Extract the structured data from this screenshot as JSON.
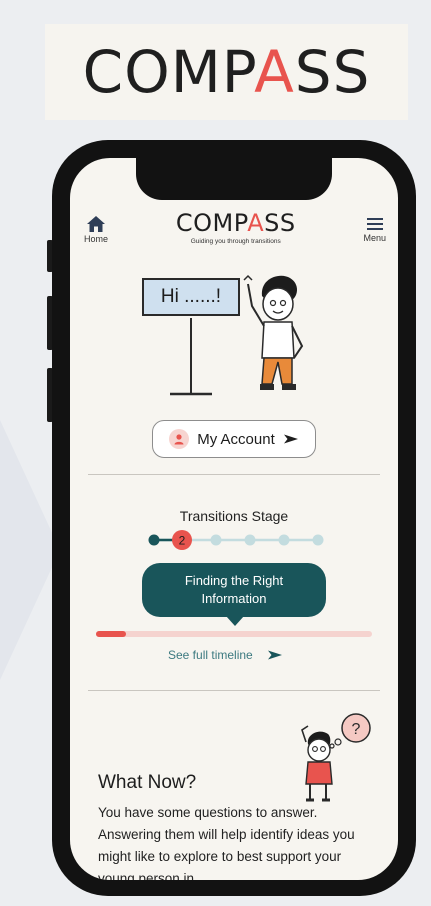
{
  "logo": {
    "left": "COMP",
    "mark": "A",
    "right": "SS"
  },
  "header": {
    "home_label": "Home",
    "brand_left": "COMP",
    "brand_mark": "A",
    "brand_right": "SS",
    "tagline": "Guiding you through transitions",
    "menu_label": "Menu"
  },
  "hero": {
    "greeting": "Hi ......!"
  },
  "account": {
    "label": "My Account"
  },
  "stage": {
    "title": "Transitions Stage",
    "current_step": "2",
    "total_steps": 6,
    "current_name_line1": "Finding the Right",
    "current_name_line2": "Information",
    "progress": 0.11,
    "timeline_link": "See full timeline"
  },
  "what_now": {
    "title": "What Now?",
    "body": "You have some questions to answer. Answering them will help identify ideas you might like to explore to best support your young person in",
    "bubble_text": "?"
  },
  "colors": {
    "accent": "#e8544e",
    "teal": "#19555a",
    "link": "#3d7a80",
    "step_inactive": "#c3dcdf"
  },
  "icons": {
    "home": "home-icon",
    "menu": "hamburger-menu-icon",
    "account": "user-icon",
    "arrow": "arrow-right-icon"
  }
}
